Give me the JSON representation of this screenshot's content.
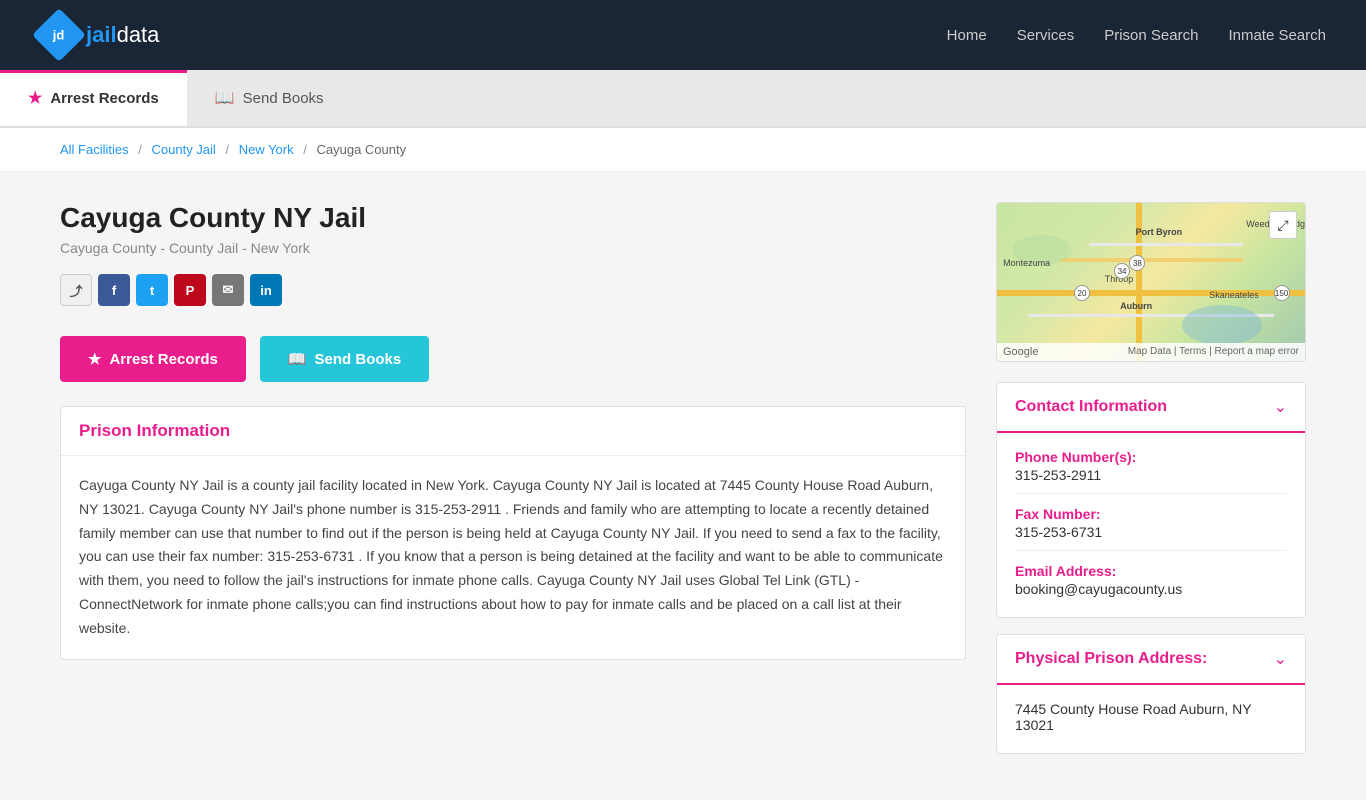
{
  "header": {
    "logo_text_jd": "jd",
    "logo_text_jail": "jail",
    "logo_text_data": "data",
    "nav": {
      "home": "Home",
      "services": "Services",
      "prison_search": "Prison Search",
      "inmate_search": "Inmate Search"
    }
  },
  "subnav": {
    "arrest_records": "Arrest Records",
    "send_books": "Send Books"
  },
  "breadcrumb": {
    "all_facilities": "All Facilities",
    "county_jail": "County Jail",
    "new_york": "New York",
    "current": "Cayuga County"
  },
  "facility": {
    "title": "Cayuga County NY Jail",
    "subtitle": "Cayuga County - County Jail - New York"
  },
  "buttons": {
    "arrest_records": "Arrest Records",
    "send_books": "Send Books"
  },
  "prison_info": {
    "heading": "Prison Information",
    "body": "Cayuga County NY Jail is a county jail facility located in New York. Cayuga County NY Jail is located at 7445 County House Road Auburn, NY 13021. Cayuga County NY Jail's phone number is 315-253-2911 . Friends and family who are attempting to locate a recently detained family member can use that number to find out if the person is being held at Cayuga County NY Jail. If you need to send a fax to the facility, you can use their fax number: 315-253-6731 . If you know that a person is being detained at the facility and want to be able to communicate with them, you need to follow the jail's instructions for inmate phone calls. Cayuga County NY Jail uses Global Tel Link (GTL) - ConnectNetwork for inmate phone calls;you can find instructions about how to pay for inmate calls and be placed on a call list at their website."
  },
  "contact": {
    "heading": "Contact Information",
    "phone_label": "Phone Number(s):",
    "phone_value": "315-253-2911",
    "fax_label": "Fax Number:",
    "fax_value": "315-253-6731",
    "email_label": "Email Address:",
    "email_value": "booking@cayugacounty.us"
  },
  "address": {
    "heading": "Physical Prison Address:",
    "value": "7445 County House Road Auburn, NY 13021"
  },
  "map": {
    "expand_icon": "⤢",
    "footer_data": "Map Data",
    "footer_terms": "Terms",
    "footer_report": "Report a map error"
  }
}
